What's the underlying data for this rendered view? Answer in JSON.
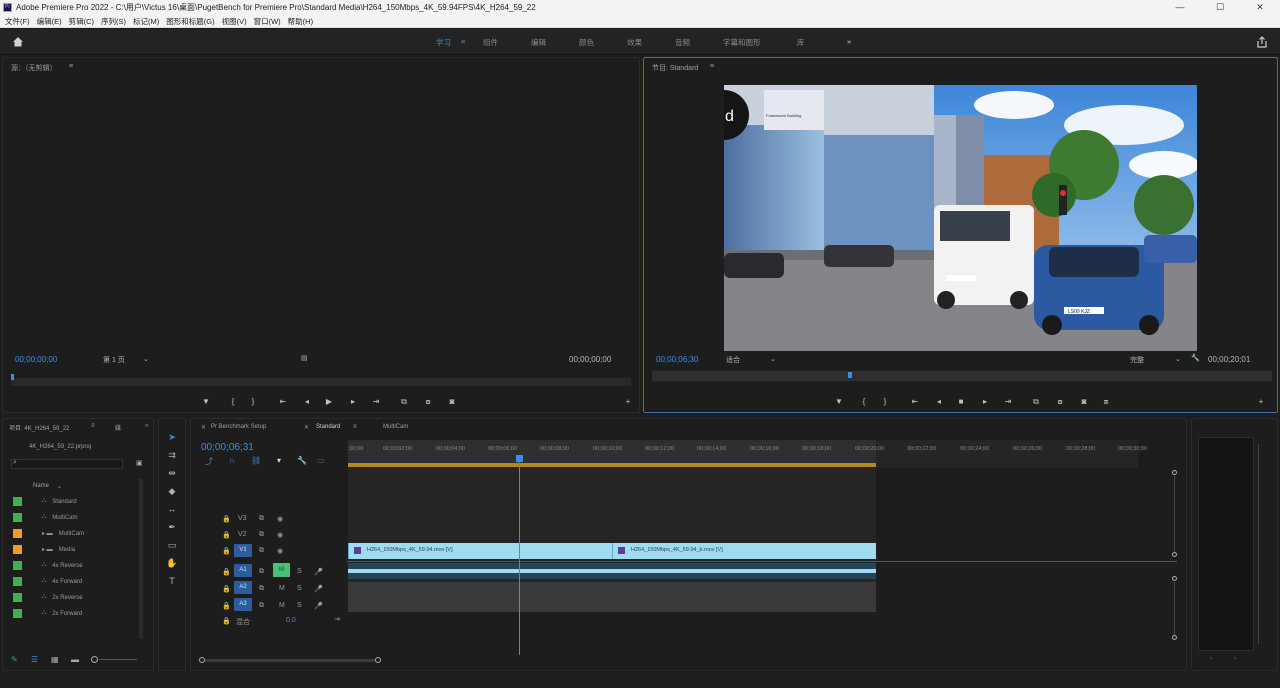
{
  "titlebar": {
    "title": "Adobe Premiere Pro 2022 - C:\\用户\\Victus 16\\桌面\\PugetBench for Premiere Pro\\Standard Media\\H264_150Mbps_4K_59.94FPS\\4K_H264_59_22",
    "minimize": "—",
    "maximize": "☐",
    "close": "✕"
  },
  "menu": [
    "文件(F)",
    "编辑(E)",
    "剪辑(C)",
    "序列(S)",
    "标记(M)",
    "图形和标题(G)",
    "视图(V)",
    "窗口(W)",
    "帮助(H)"
  ],
  "workspaces": [
    "学习",
    "组件",
    "编辑",
    "颜色",
    "效果",
    "音频",
    "字幕和图形",
    "库"
  ],
  "workspace_active": "学习",
  "workspace_more": "»",
  "source": {
    "tab": "源：（无剪辑）",
    "tc_in": "00;00;00;00",
    "page": "第 1 页",
    "tc_out": "00;00;00;00"
  },
  "program": {
    "tab": "节目: Standard",
    "tc_in": "00;00;06;30",
    "fit": "适合",
    "quality": "完整",
    "tc_out": "00;00;20;01",
    "video_labels": {
      "building_sign": "Framework Building",
      "plate": "LS09 KJZ"
    }
  },
  "project": {
    "tab1": "项目: 4K_H264_59_22",
    "tab2": "媒",
    "file": "4K_H264_59_22.prproj",
    "col_name": "Name",
    "items": [
      {
        "name": "Standard",
        "color": "#3fb24a"
      },
      {
        "name": "MultiCam",
        "color": "#3fb24a"
      },
      {
        "name": "MultiCam",
        "color": "#f09a2f"
      },
      {
        "name": "Media",
        "color": "#f09a2f"
      },
      {
        "name": "4x Reverse",
        "color": "#3fb24a"
      },
      {
        "name": "4x Forward",
        "color": "#3fb24a"
      },
      {
        "name": "2x Reverse",
        "color": "#3fb24a"
      },
      {
        "name": "2x Forward",
        "color": "#3fb24a"
      }
    ]
  },
  "timeline": {
    "tabs": [
      "Pr Benchmark Setup",
      "Standard",
      "MultiCam"
    ],
    "active_tab": "Standard",
    "tc": "00;00;06;31",
    "ruler": [
      ";00;00",
      "00;00;02;00",
      "00;00;04;00",
      "00;00;06;00",
      "00;00;08;00",
      "00;00;10;00",
      "00;00;12;00",
      "00;00;14;00",
      "00;00;16;00",
      "00;00;18;00",
      "00;00;20;00",
      "00;00;22;00",
      "00;00;24;00",
      "00;00;26;00",
      "00;00;28;00",
      "00;00;30;00"
    ],
    "video_tracks": [
      "V3",
      "V2",
      "V1"
    ],
    "audio_tracks": [
      "A1",
      "A2",
      "A3"
    ],
    "mix_label": "混合",
    "mix_value": "0.0",
    "clip1": "H264_150Mbps_4K_59.94.mov [V]",
    "clip2": "H264_150Mbps_4K_59.94_b.mov [V]"
  },
  "colors": {
    "accent": "#3a8ee6",
    "clip": "#9fdcf0",
    "panel": "#1d1d1d"
  }
}
